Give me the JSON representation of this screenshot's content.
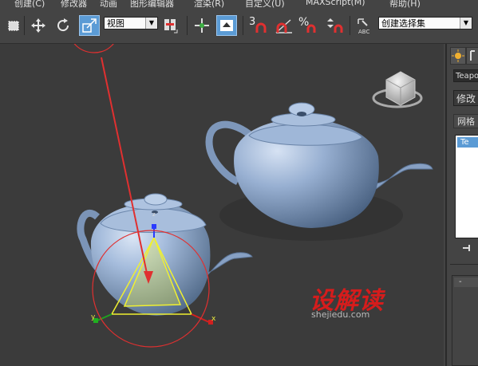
{
  "menu": {
    "items": [
      "创建(C)",
      "修改器",
      "动画",
      "图形编辑器",
      "渲染(R)",
      "自定义(U)",
      "MAXScript(M)",
      "帮助(H)"
    ]
  },
  "toolbar": {
    "view_dropdown": "视图",
    "snap_value": "3",
    "percent_symbol": "%",
    "selection_set_dropdown": "创建选择集"
  },
  "viewport": {
    "gizmo_labels": {
      "x": "x",
      "y": "y",
      "z": "z"
    },
    "watermark": {
      "brand": "设解读",
      "url": "shejiedu.com"
    }
  },
  "command_panel": {
    "object_name": "Teapo",
    "modifier_list": "修改器",
    "section_label": "网格",
    "stack_item": "Te",
    "rollout_label": "-"
  },
  "colors": {
    "ui_background": "#444444",
    "viewport_background": "#3b3b3b",
    "teapot": "#8fa8c8",
    "annotation_red": "#e03030",
    "selection_highlight": "#5b9bd5",
    "gizmo_yellow": "#f0f030"
  }
}
